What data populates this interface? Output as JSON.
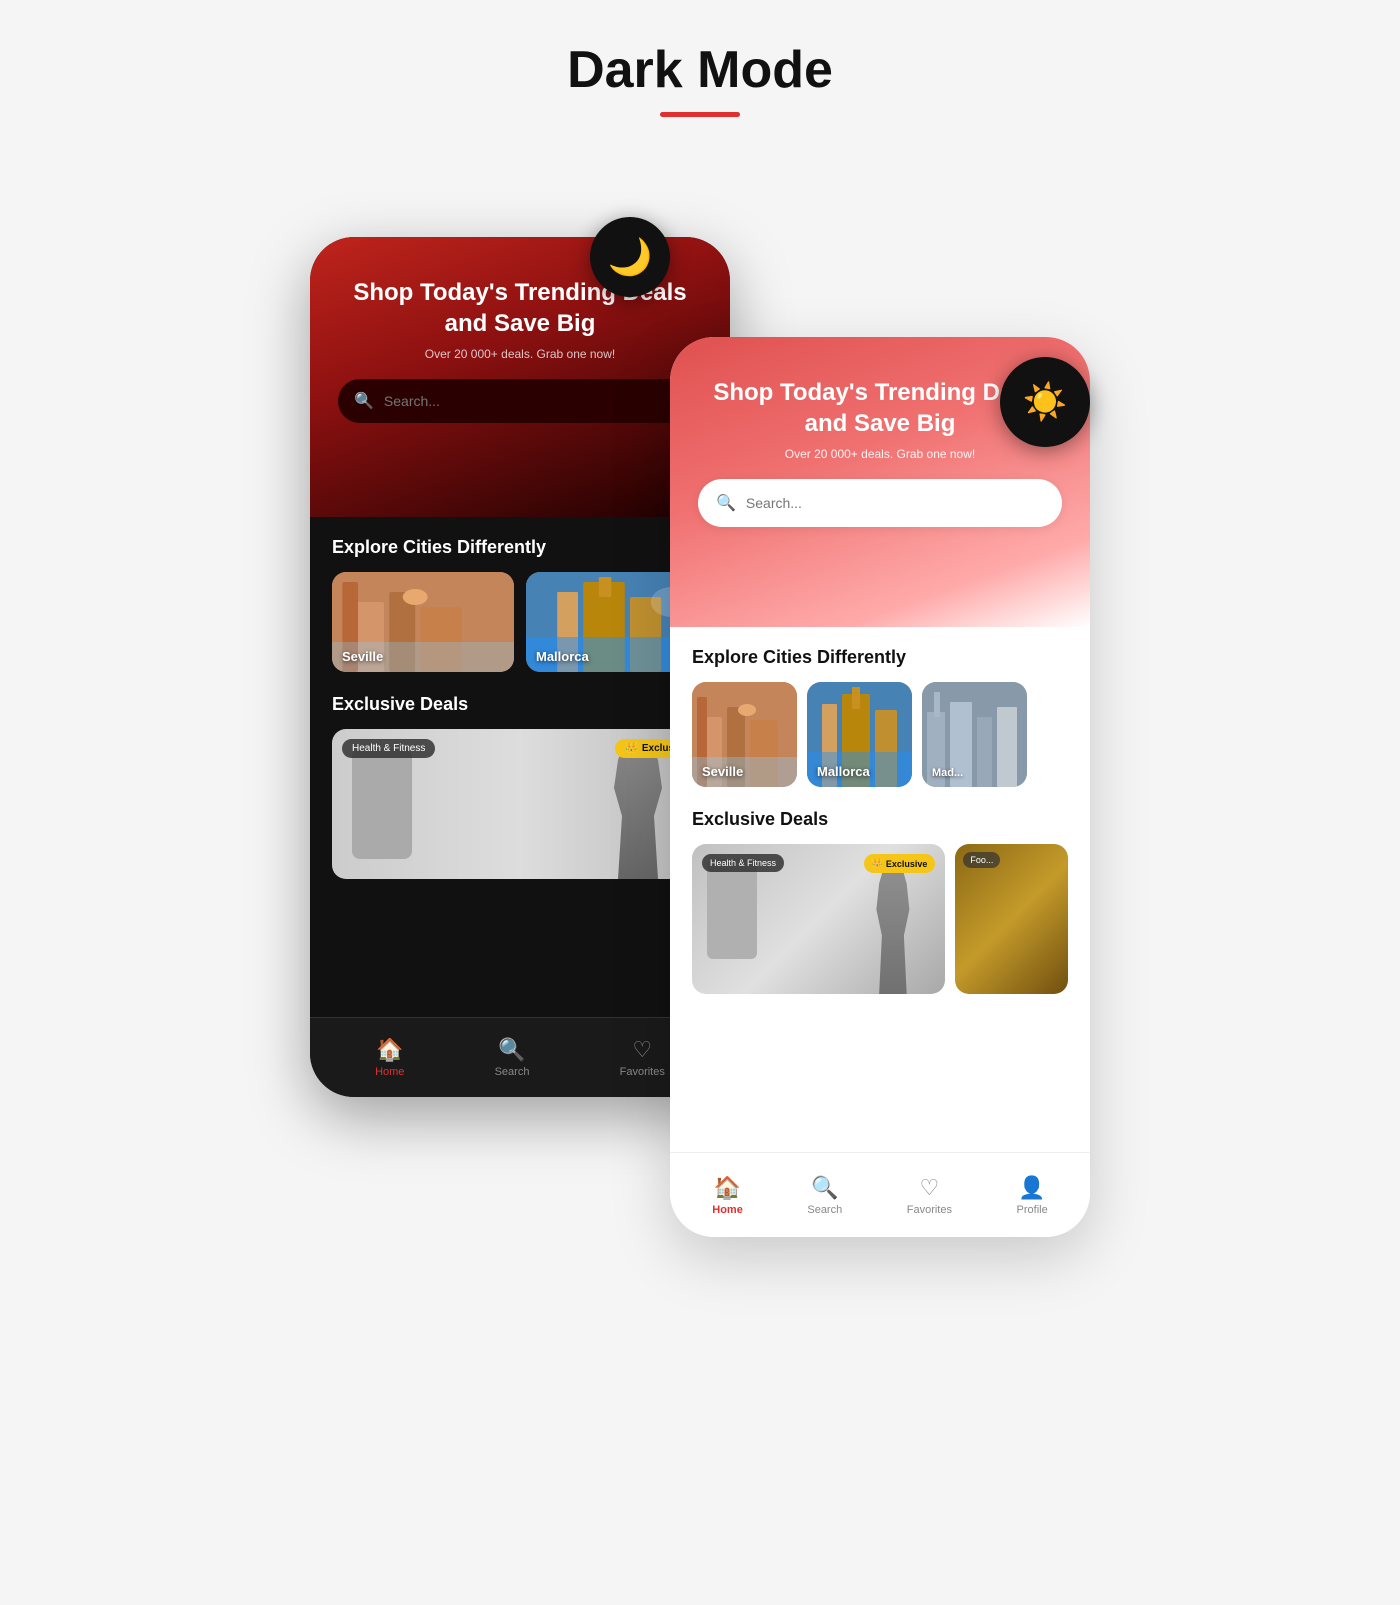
{
  "page": {
    "title": "Dark Mode",
    "accent_color": "#e03030",
    "underline_color": "#e03030"
  },
  "dark_phone": {
    "header": {
      "hero_title": "Shop Today's Trending Deals and Save Big",
      "hero_sub": "Over 20 000+ deals. Grab one now!",
      "search_placeholder": "Search..."
    },
    "sections": {
      "cities_title": "Explore Cities Differently",
      "cities": [
        {
          "name": "Seville"
        },
        {
          "name": "Mallorca"
        }
      ],
      "deals_title": "Exclusive Deals",
      "deals": [
        {
          "badge": "Health & Fitness",
          "exclusive": "Exclusive"
        }
      ]
    },
    "nav": [
      {
        "label": "Home",
        "active": true
      },
      {
        "label": "Search",
        "active": false
      },
      {
        "label": "Favorites",
        "active": false
      }
    ]
  },
  "light_phone": {
    "header": {
      "hero_title": "Shop Today's Trending Deals and Save Big",
      "hero_sub": "Over 20 000+ deals. Grab one now!",
      "search_placeholder": "Search..."
    },
    "sections": {
      "cities_title": "Explore Cities Differently",
      "cities": [
        {
          "name": "Seville"
        },
        {
          "name": "Mallorca"
        },
        {
          "name": "Mad..."
        }
      ],
      "deals_title": "Exclusive Deals",
      "deals": [
        {
          "badge": "Health & Fitness",
          "exclusive": "Exclusive"
        },
        {
          "badge": "Foo..."
        }
      ]
    },
    "nav": [
      {
        "label": "Home",
        "active": true
      },
      {
        "label": "Search",
        "active": false
      },
      {
        "label": "Favorites",
        "active": false
      },
      {
        "label": "Profile",
        "active": false
      }
    ]
  },
  "badges": {
    "moon": "🌙",
    "sun": "☀️"
  }
}
